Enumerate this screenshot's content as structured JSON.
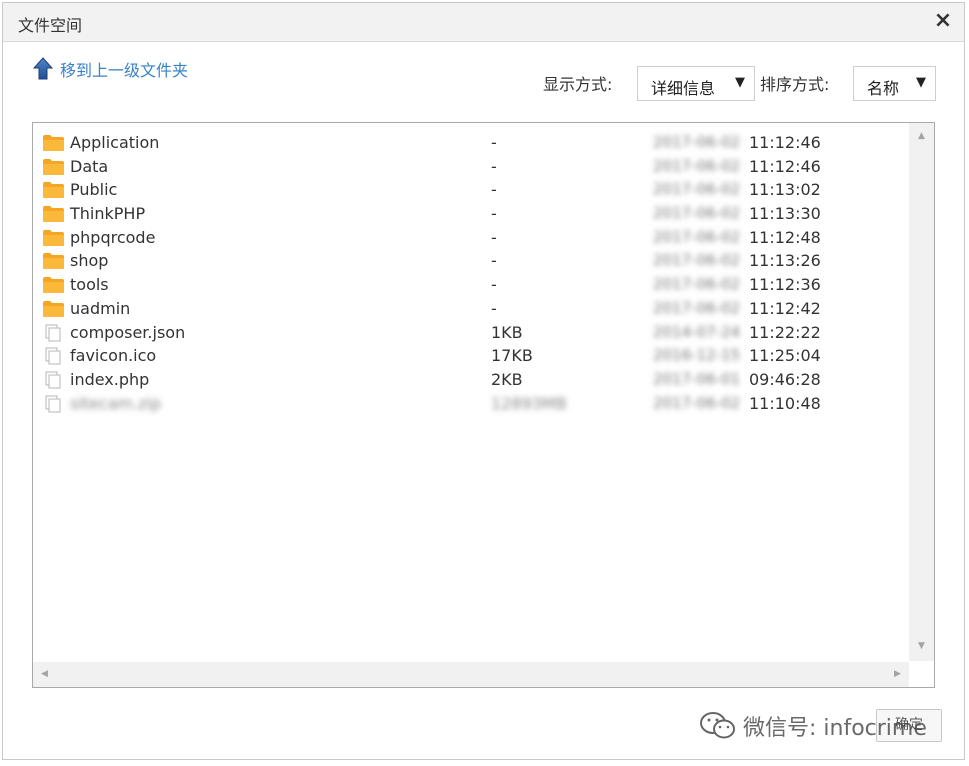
{
  "dialog": {
    "title": "文件空间",
    "close_glyph": "×"
  },
  "toolbar": {
    "up_label": "移到上一级文件夹",
    "view_label": "显示方式:",
    "view_value": "详细信息",
    "sort_label": "排序方式:",
    "sort_value": "名称",
    "caret": "▼"
  },
  "files": [
    {
      "type": "folder",
      "name": "Application",
      "size": "-",
      "date": "2017-06-02",
      "time": "11:12:46"
    },
    {
      "type": "folder",
      "name": "Data",
      "size": "-",
      "date": "2017-06-02",
      "time": "11:12:46"
    },
    {
      "type": "folder",
      "name": "Public",
      "size": "-",
      "date": "2017-06-02",
      "time": "11:13:02"
    },
    {
      "type": "folder",
      "name": "ThinkPHP",
      "size": "-",
      "date": "2017-06-02",
      "time": "11:13:30"
    },
    {
      "type": "folder",
      "name": "phpqrcode",
      "size": "-",
      "date": "2017-06-02",
      "time": "11:12:48"
    },
    {
      "type": "folder",
      "name": "shop",
      "size": "-",
      "date": "2017-06-02",
      "time": "11:13:26"
    },
    {
      "type": "folder",
      "name": "tools",
      "size": "-",
      "date": "2017-06-02",
      "time": "11:12:36"
    },
    {
      "type": "folder",
      "name": "uadmin",
      "size": "-",
      "date": "2017-06-02",
      "time": "11:12:42"
    },
    {
      "type": "file",
      "name": "composer.json",
      "size": "1KB",
      "date": "2014-07-24",
      "time": "11:22:22"
    },
    {
      "type": "file",
      "name": "favicon.ico",
      "size": "17KB",
      "date": "2016-12-15",
      "time": "11:25:04"
    },
    {
      "type": "file",
      "name": "index.php",
      "size": "2KB",
      "date": "2017-06-01",
      "time": "09:46:28"
    },
    {
      "type": "file",
      "name": "sitecam.zip",
      "size": "12893MB",
      "date": "2017-06-02",
      "time": "11:10:48",
      "blurred": true
    }
  ],
  "scrollbar": {
    "up": "▲",
    "down": "▼",
    "left": "◀",
    "right": "▶"
  },
  "footer": {
    "button_label": "确定"
  },
  "watermark": {
    "text": "微信号: infocrime",
    "icon": "wechat-icon"
  },
  "colors": {
    "folder": "#f6a623",
    "link": "#3a82c8",
    "arrow_blue": "#2b5fa8"
  }
}
